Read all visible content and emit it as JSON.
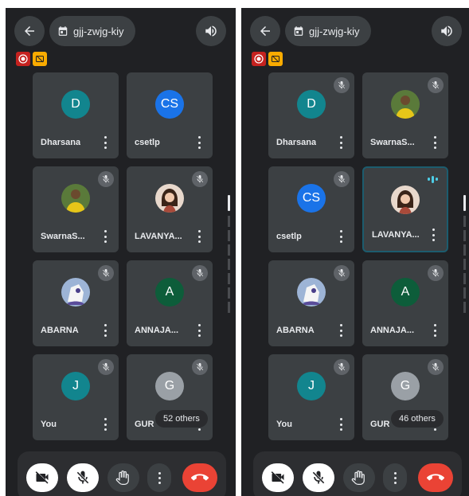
{
  "colors": {
    "background": "#202124",
    "tile": "#3c4043",
    "end_call": "#ea4335",
    "speaking": "#4ecde6",
    "recording": "#c5221f",
    "captions": "#f9ab00"
  },
  "icons": {
    "back": "arrow-left-icon",
    "calendar": "calendar-icon",
    "speaker": "volume-icon",
    "recording": "record-icon",
    "captions": "captions-off-icon",
    "muted": "mic-off-icon",
    "more": "more-vert-icon",
    "camera_off": "camera-off-icon",
    "raise_hand": "hand-icon",
    "end_call": "call-end-icon"
  },
  "screens": [
    {
      "meeting_code": "gjj-zwjg-kiy",
      "tiles": [
        {
          "initials": "D",
          "name": "Dharsana",
          "avatar_color": "#12858e",
          "muted": false
        },
        {
          "initials": "CS",
          "name": "csetlp",
          "avatar_color": "#1a73e8",
          "muted": false
        },
        {
          "initials": "",
          "name": "SwarnaS...",
          "avatar_color": "#6b8e23",
          "muted": true,
          "photo": "yellow"
        },
        {
          "initials": "",
          "name": "LAVANYA...",
          "avatar_color": "#8d5a3c",
          "muted": true,
          "photo": "person"
        },
        {
          "initials": "",
          "name": "ABARNA",
          "avatar_color": "#8fa8c8",
          "muted": true,
          "photo": "cartoon"
        },
        {
          "initials": "A",
          "name": "ANNAJA...",
          "avatar_color": "#0d5d3a",
          "muted": true
        },
        {
          "initials": "J",
          "name": "You",
          "avatar_color": "#12858e",
          "muted": true
        },
        {
          "initials": "G",
          "name": "GUR",
          "avatar_color": "#9aa0a6",
          "muted": true,
          "others": "52 others"
        }
      ]
    },
    {
      "meeting_code": "gjj-zwjg-kiy",
      "tiles": [
        {
          "initials": "D",
          "name": "Dharsana",
          "avatar_color": "#12858e",
          "muted": true
        },
        {
          "initials": "",
          "name": "SwarnaS...",
          "avatar_color": "#6b8e23",
          "muted": true,
          "photo": "yellow"
        },
        {
          "initials": "CS",
          "name": "csetlp",
          "avatar_color": "#1a73e8",
          "muted": true
        },
        {
          "initials": "",
          "name": "LAVANYA...",
          "avatar_color": "#8d5a3c",
          "muted": false,
          "speaking": true,
          "photo": "person"
        },
        {
          "initials": "",
          "name": "ABARNA",
          "avatar_color": "#8fa8c8",
          "muted": true,
          "photo": "cartoon"
        },
        {
          "initials": "A",
          "name": "ANNAJA...",
          "avatar_color": "#0d5d3a",
          "muted": true
        },
        {
          "initials": "J",
          "name": "You",
          "avatar_color": "#12858e",
          "muted": true
        },
        {
          "initials": "G",
          "name": "GUR",
          "avatar_color": "#9aa0a6",
          "muted": true,
          "others": "46 others"
        }
      ]
    }
  ]
}
